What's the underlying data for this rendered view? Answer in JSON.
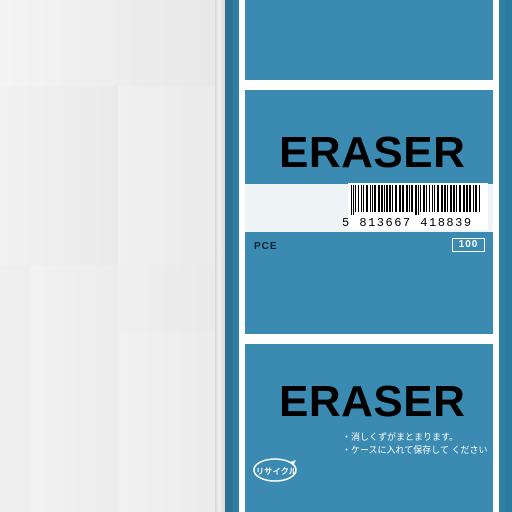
{
  "product": {
    "top_word": "ERASER",
    "bottom_word": "ERASER",
    "barcode_number": "5 813667 418839",
    "pce_label": "PCE",
    "count": "100",
    "recycle_label": "リサイクル",
    "notes": [
      "消しくずがまとまります。",
      "ケースに入れて保存して ください"
    ],
    "note_bullet": "・"
  },
  "colors": {
    "sleeve_blue": "#2f7fa3",
    "panel_blue": "#3b8ab1",
    "eraser_white": "#f4f4f4",
    "text_black": "#000000"
  }
}
